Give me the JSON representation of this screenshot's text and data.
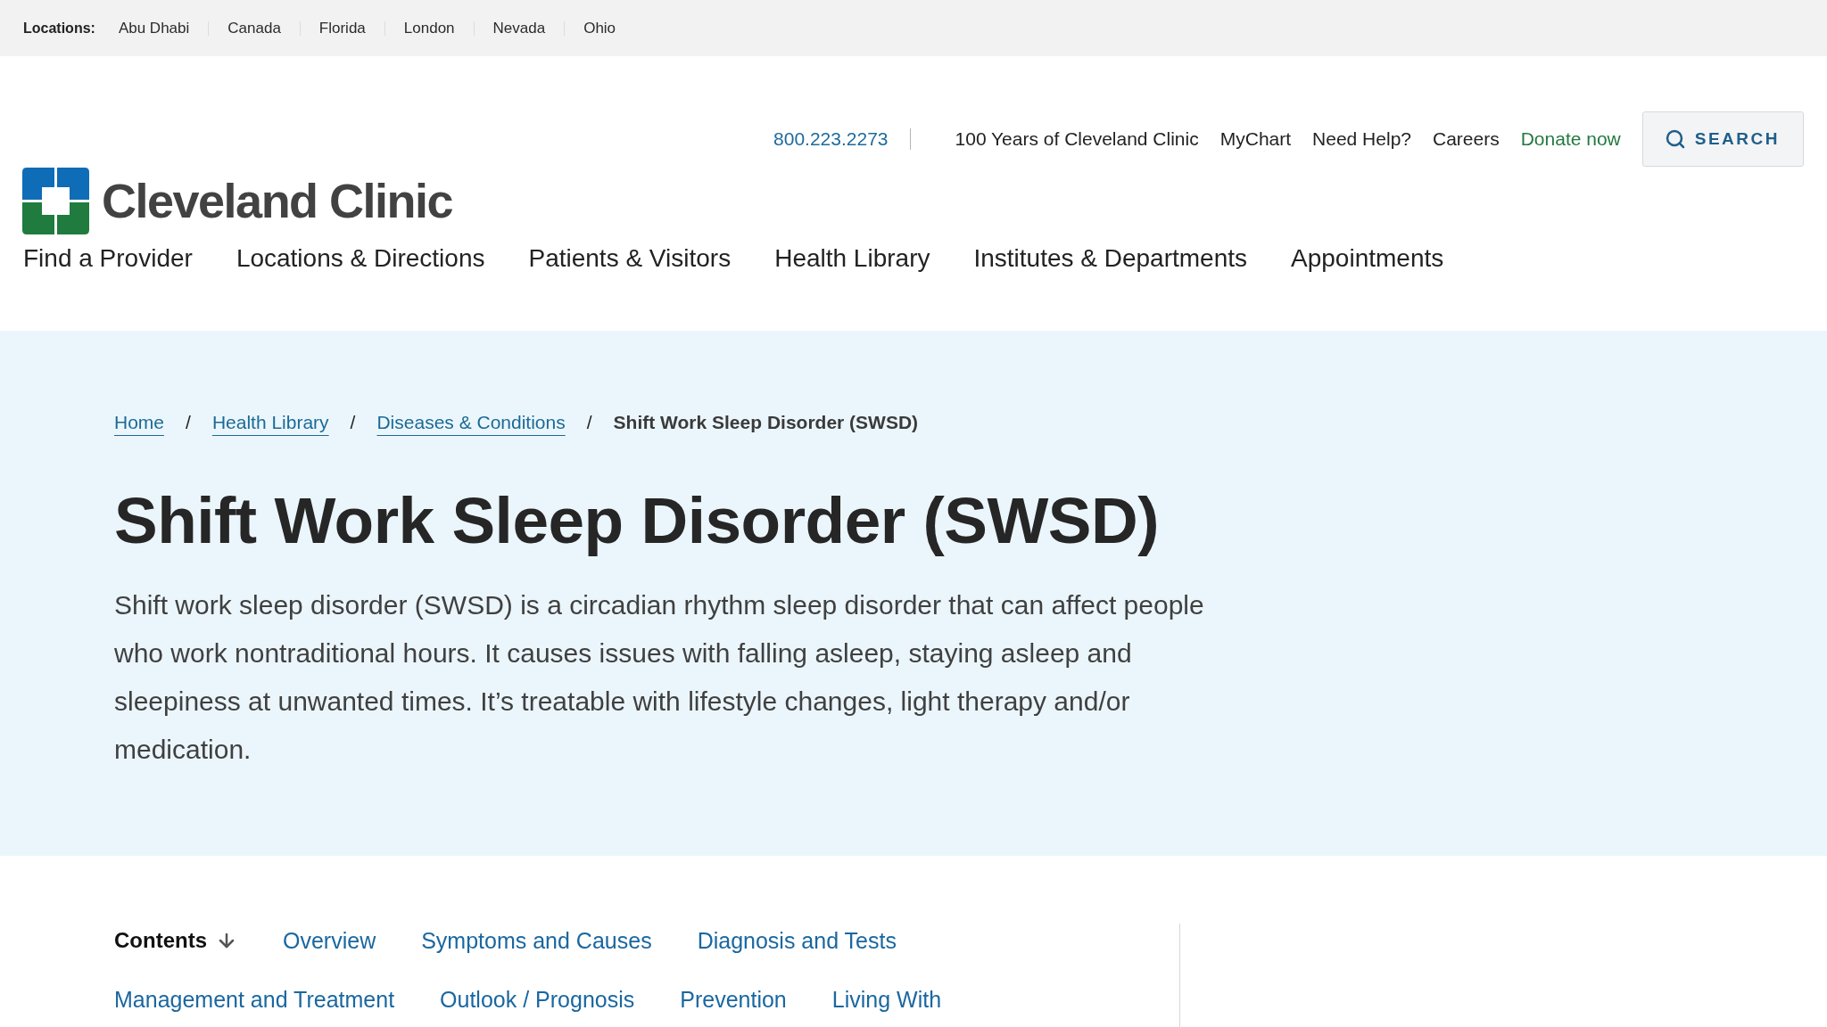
{
  "location_bar": {
    "label": "Locations:",
    "items": [
      "Abu Dhabi",
      "Canada",
      "Florida",
      "London",
      "Nevada",
      "Ohio"
    ]
  },
  "utility_nav": {
    "links": [
      {
        "label": "800.223.2273",
        "kind": "phone"
      },
      {
        "label": "100 Years of Cleveland Clinic",
        "kind": "link"
      },
      {
        "label": "MyChart",
        "kind": "link"
      },
      {
        "label": "Need Help?",
        "kind": "link"
      },
      {
        "label": "Careers",
        "kind": "link"
      },
      {
        "label": "Donate now",
        "kind": "donate"
      }
    ],
    "search_button": "SEARCH"
  },
  "logo": {
    "text": "Cleveland Clinic"
  },
  "main_nav": [
    "Find a Provider",
    "Locations & Directions",
    "Patients & Visitors",
    "Health Library",
    "Institutes & Departments",
    "Appointments"
  ],
  "hero": {
    "breadcrumb": [
      {
        "label": "Home",
        "kind": "link"
      },
      {
        "label": "/",
        "kind": "separator"
      },
      {
        "label": "Health Library",
        "kind": "link"
      },
      {
        "label": "/",
        "kind": "separator"
      },
      {
        "label": "Diseases & Conditions",
        "kind": "link"
      },
      {
        "label": "/",
        "kind": "separator"
      },
      {
        "label": "Shift Work Sleep Disorder (SWSD)",
        "kind": "current"
      }
    ],
    "title": "Shift Work Sleep Disorder (SWSD)",
    "summary": "Shift work sleep disorder (SWSD) is a circadian rhythm sleep disorder that can affect people who work nontraditional hours. It causes issues with falling asleep, staying asleep and sleepiness at unwanted times. It’s treatable with lifestyle changes, light therapy and/or medication."
  },
  "contents": {
    "label": "Contents",
    "links": [
      "Overview",
      "Symptoms and Causes",
      "Diagnosis and Tests",
      "Management and Treatment",
      "Outlook / Prognosis",
      "Prevention",
      "Living With"
    ]
  }
}
